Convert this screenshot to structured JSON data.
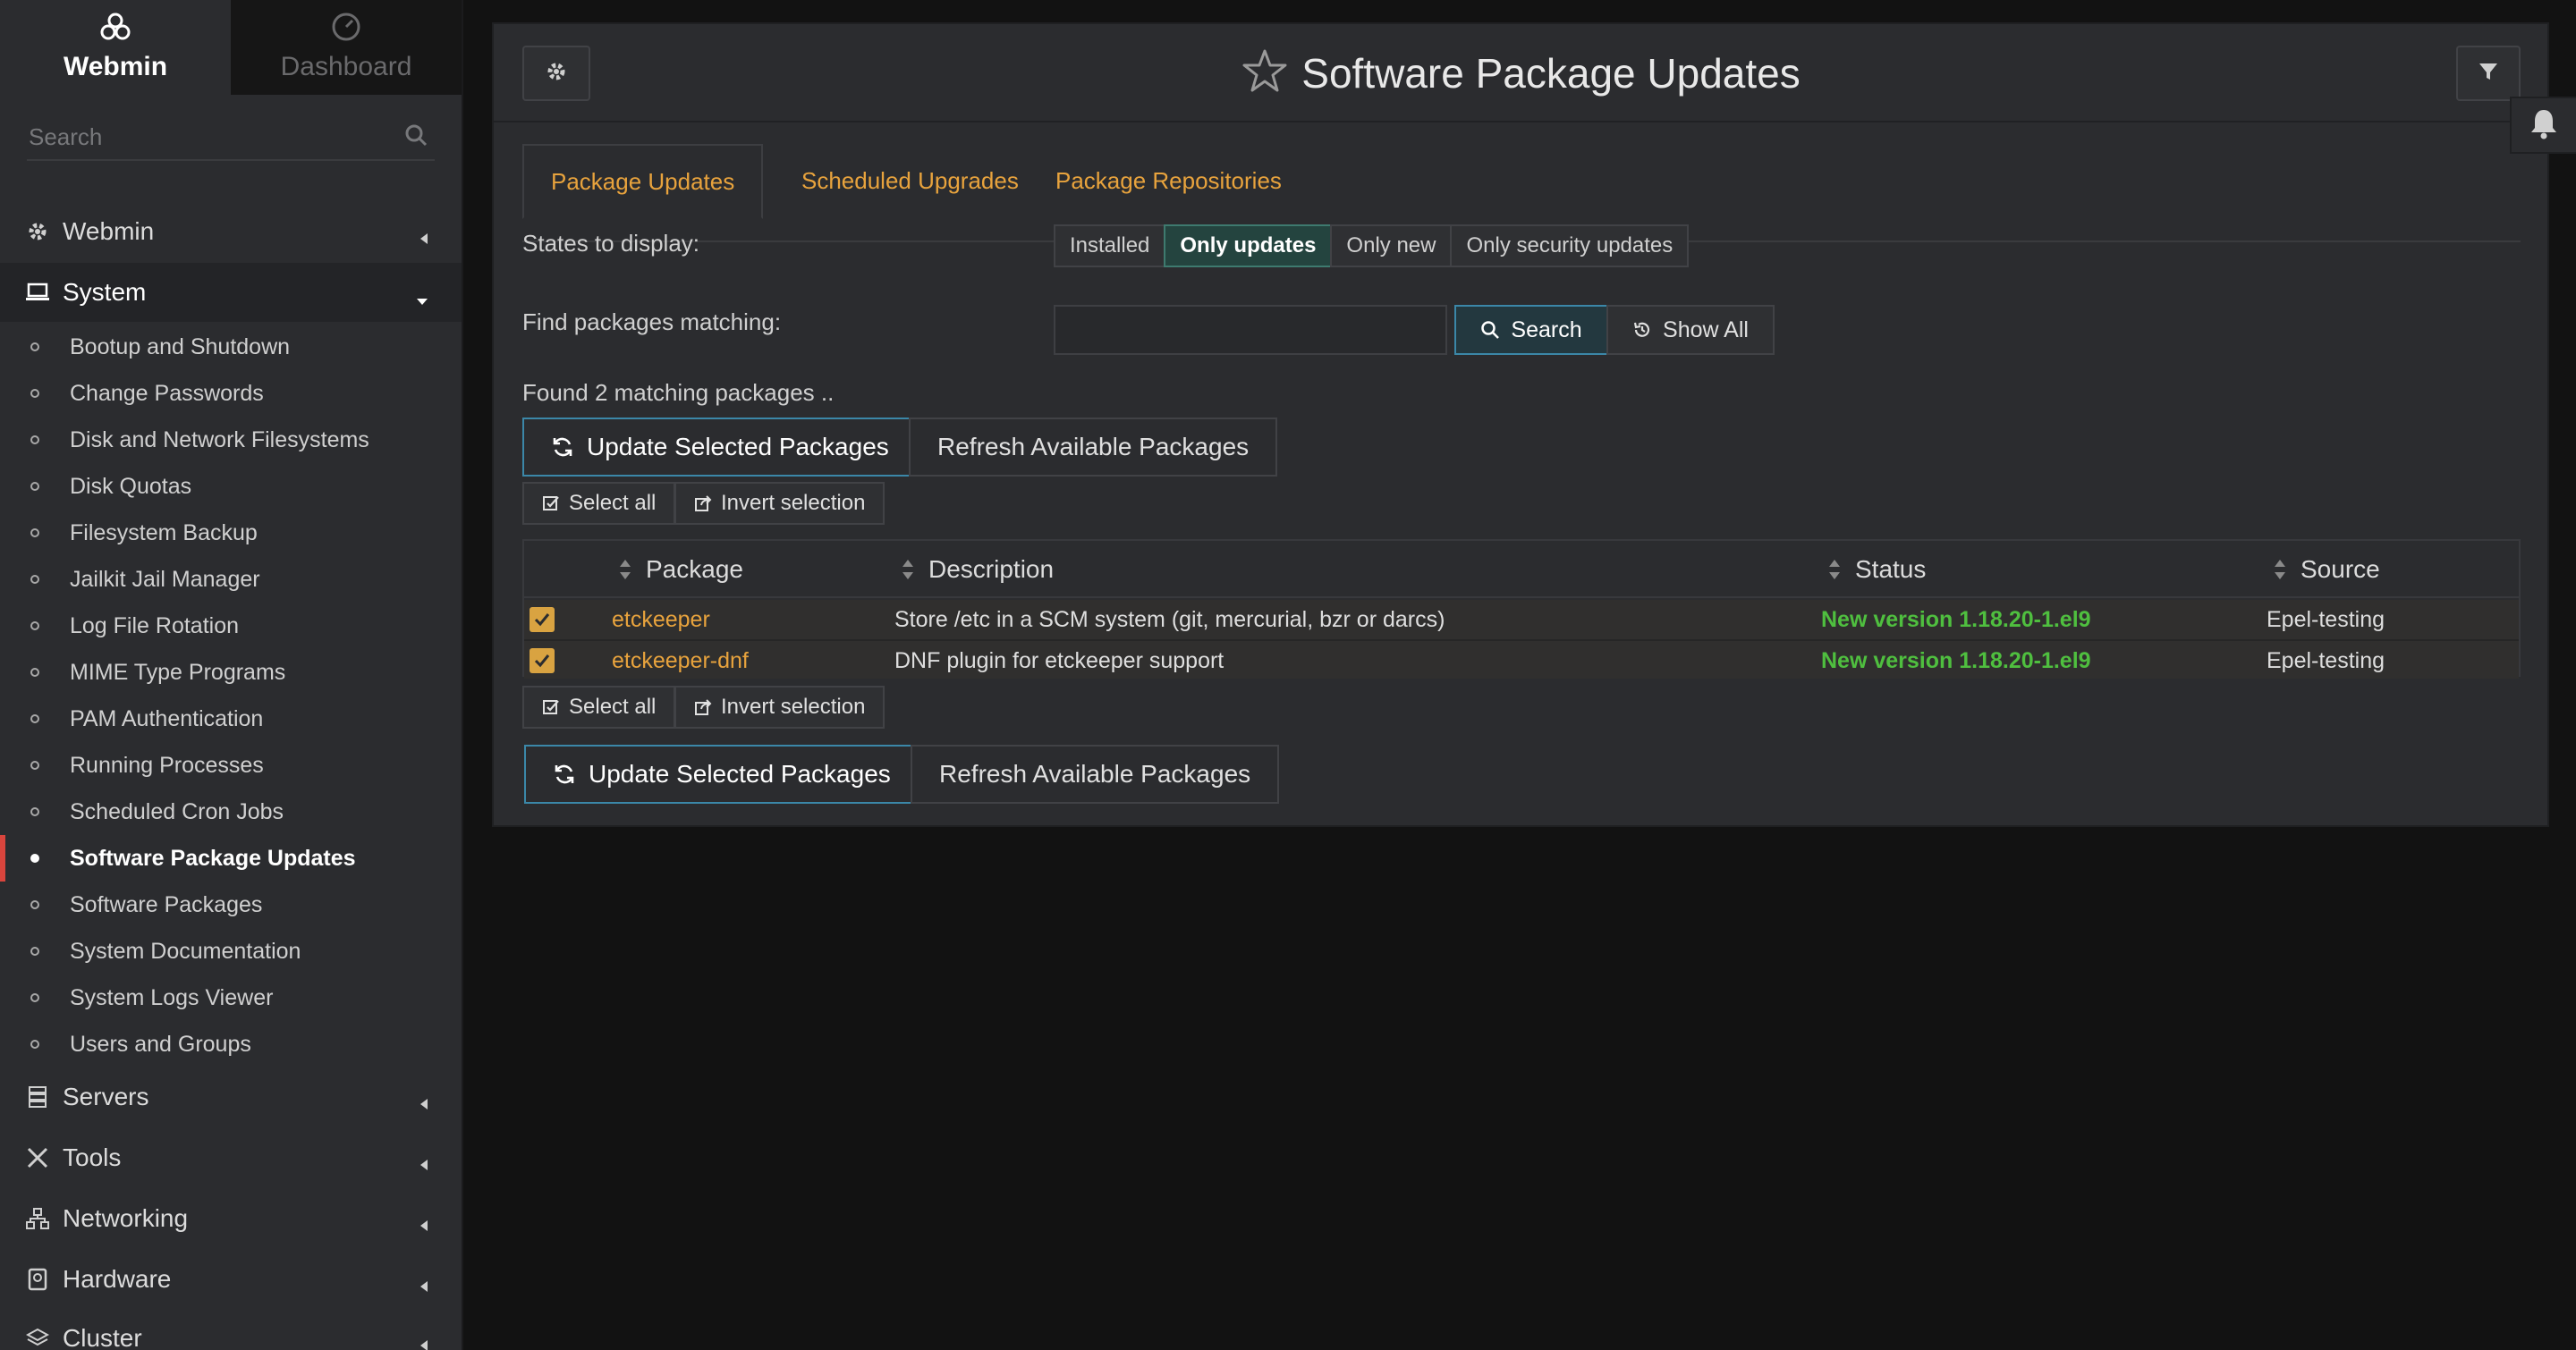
{
  "brand": {
    "webmin_label": "Webmin",
    "dashboard_label": "Dashboard"
  },
  "sidebar": {
    "search_placeholder": "Search",
    "categories": [
      {
        "label": "Webmin"
      },
      {
        "label": "System"
      },
      {
        "label": "Servers"
      },
      {
        "label": "Tools"
      },
      {
        "label": "Networking"
      },
      {
        "label": "Hardware"
      },
      {
        "label": "Cluster"
      }
    ],
    "system_items": [
      "Bootup and Shutdown",
      "Change Passwords",
      "Disk and Network Filesystems",
      "Disk Quotas",
      "Filesystem Backup",
      "Jailkit Jail Manager",
      "Log File Rotation",
      "MIME Type Programs",
      "PAM Authentication",
      "Running Processes",
      "Scheduled Cron Jobs",
      "Software Package Updates",
      "Software Packages",
      "System Documentation",
      "System Logs Viewer",
      "Users and Groups"
    ],
    "active_item": "Software Package Updates"
  },
  "header": {
    "title": "Software Package Updates"
  },
  "tabs": [
    {
      "label": "Package Updates",
      "active": true
    },
    {
      "label": "Scheduled Upgrades",
      "active": false
    },
    {
      "label": "Package Repositories",
      "active": false
    }
  ],
  "filters": {
    "states_label": "States to display:",
    "states": [
      "Installed",
      "Only updates",
      "Only new",
      "Only security updates"
    ],
    "selected_state": "Only updates",
    "find_label": "Find packages matching:",
    "find_value": "",
    "search_button": "Search",
    "show_all_button": "Show All"
  },
  "results": {
    "found_text": "Found 2 matching packages ..",
    "update_button": "Update Selected Packages",
    "refresh_button": "Refresh Available Packages",
    "select_all": "Select all",
    "invert_selection": "Invert selection"
  },
  "table": {
    "columns": [
      "Package",
      "Description",
      "Status",
      "Source"
    ],
    "rows": [
      {
        "checked": true,
        "package": "etckeeper",
        "description": "Store /etc in a SCM system (git, mercurial, bzr or darcs)",
        "status": "New version 1.18.20-1.el9",
        "source": "Epel-testing"
      },
      {
        "checked": true,
        "package": "etckeeper-dnf",
        "description": "DNF plugin for etckeeper support",
        "status": "New version 1.18.20-1.el9",
        "source": "Epel-testing"
      }
    ]
  },
  "colors": {
    "accent_link": "#e8a33d",
    "status_green": "#4fbf3f",
    "primary_border": "#3b87a8",
    "active_marker": "#d9453d"
  }
}
